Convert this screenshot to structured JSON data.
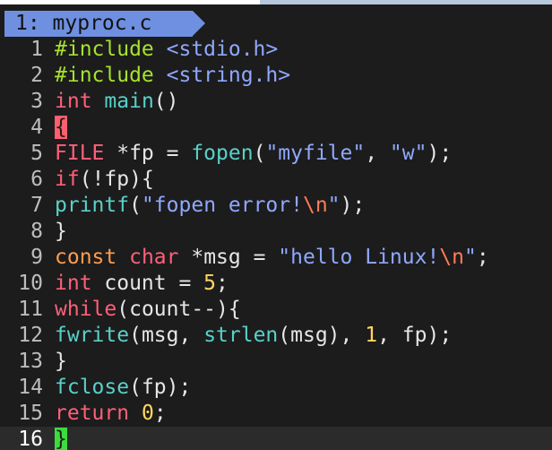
{
  "tab": {
    "label": "1: myproc.c"
  },
  "colors": {
    "tab_bg": "#6f8fe0",
    "background": "#1c1c1c",
    "match_brace": "#ff5f6d",
    "cursor": "#3ddc3d"
  },
  "lines": [
    {
      "n": "1",
      "tokens": [
        [
          "pre",
          "#include "
        ],
        [
          "str",
          "<stdio.h>"
        ]
      ]
    },
    {
      "n": "2",
      "tokens": [
        [
          "pre",
          "#include "
        ],
        [
          "str",
          "<string.h>"
        ]
      ]
    },
    {
      "n": "3",
      "tokens": [
        [
          "type",
          "int"
        ],
        [
          "plain",
          " "
        ],
        [
          "fn",
          "main"
        ],
        [
          "plain",
          "()"
        ]
      ]
    },
    {
      "n": "4",
      "tokens": [
        [
          "match",
          "{"
        ]
      ]
    },
    {
      "n": "5",
      "tokens": [
        [
          "type",
          "FILE"
        ],
        [
          "plain",
          " *fp = "
        ],
        [
          "fn",
          "fopen"
        ],
        [
          "plain",
          "("
        ],
        [
          "str",
          "\"myfile\""
        ],
        [
          "plain",
          ", "
        ],
        [
          "str",
          "\"w\""
        ],
        [
          "plain",
          ");"
        ]
      ]
    },
    {
      "n": "6",
      "tokens": [
        [
          "kw",
          "if"
        ],
        [
          "plain",
          "(!fp){"
        ]
      ]
    },
    {
      "n": "7",
      "tokens": [
        [
          "fn",
          "printf"
        ],
        [
          "plain",
          "("
        ],
        [
          "str",
          "\"fopen error!"
        ],
        [
          "esc",
          "\\n"
        ],
        [
          "str",
          "\""
        ],
        [
          "plain",
          ");"
        ]
      ]
    },
    {
      "n": "8",
      "tokens": [
        [
          "plain",
          "}"
        ]
      ]
    },
    {
      "n": "9",
      "tokens": [
        [
          "const",
          "const"
        ],
        [
          "plain",
          " "
        ],
        [
          "type",
          "char"
        ],
        [
          "plain",
          " *msg = "
        ],
        [
          "str",
          "\"hello Linux!"
        ],
        [
          "esc",
          "\\n"
        ],
        [
          "str",
          "\""
        ],
        [
          "plain",
          ";"
        ]
      ]
    },
    {
      "n": "10",
      "tokens": [
        [
          "type",
          "int"
        ],
        [
          "plain",
          " count = "
        ],
        [
          "num",
          "5"
        ],
        [
          "plain",
          ";"
        ]
      ]
    },
    {
      "n": "11",
      "tokens": [
        [
          "kw",
          "while"
        ],
        [
          "plain",
          "(count--){"
        ]
      ]
    },
    {
      "n": "12",
      "tokens": [
        [
          "fn",
          "fwrite"
        ],
        [
          "plain",
          "(msg, "
        ],
        [
          "fn",
          "strlen"
        ],
        [
          "plain",
          "(msg), "
        ],
        [
          "num",
          "1"
        ],
        [
          "plain",
          ", fp);"
        ]
      ]
    },
    {
      "n": "13",
      "tokens": [
        [
          "plain",
          "}"
        ]
      ]
    },
    {
      "n": "14",
      "tokens": [
        [
          "fn",
          "fclose"
        ],
        [
          "plain",
          "(fp);"
        ]
      ]
    },
    {
      "n": "15",
      "tokens": [
        [
          "kw",
          "return"
        ],
        [
          "plain",
          " "
        ],
        [
          "num",
          "0"
        ],
        [
          "plain",
          ";"
        ]
      ]
    },
    {
      "n": "16",
      "tokens": [
        [
          "cursor",
          "}"
        ]
      ],
      "current": true
    }
  ]
}
